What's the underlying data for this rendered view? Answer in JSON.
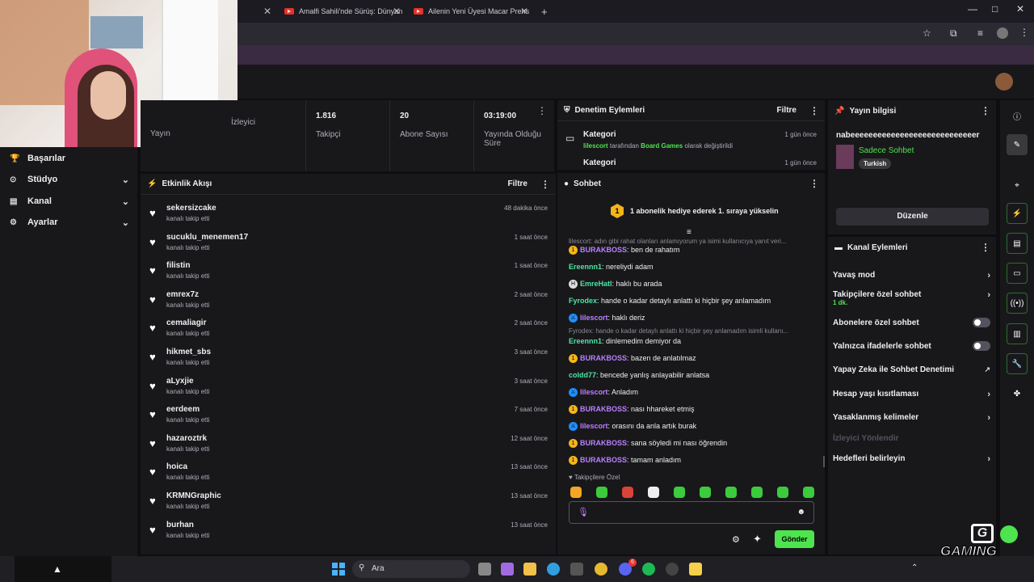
{
  "browser": {
    "tabs": [
      {
        "title": "Amalfi Sahili'nde Sürüş: Dünyan"
      },
      {
        "title": "Ailenin Yeni Üyesi Macar Prens"
      }
    ],
    "new_tab": "+"
  },
  "sidebar": {
    "items": [
      {
        "label": "Başarılar",
        "icon": "trophy-icon"
      },
      {
        "label": "Stüdyo",
        "icon": "studio-icon"
      },
      {
        "label": "Kanal",
        "icon": "channel-icon"
      },
      {
        "label": "Ayarlar",
        "icon": "gear-icon"
      }
    ]
  },
  "stats": {
    "items": [
      {
        "value": "",
        "label": "Yayın"
      },
      {
        "value": "",
        "label": "İzleyici"
      },
      {
        "value": "1.816",
        "label": "Takipçi"
      },
      {
        "value": "20",
        "label": "Abone Sayısı"
      },
      {
        "value": "03:19:00",
        "label": "Yayında Olduğu Süre"
      }
    ]
  },
  "activity": {
    "title": "Etkinlik Akışı",
    "filter": "Filtre",
    "events": [
      {
        "name": "sekersizcake",
        "sub": "kanalı takip etti",
        "time": "48 dakika önce"
      },
      {
        "name": "sucuklu_menemen17",
        "sub": "kanalı takip etti",
        "time": "1 saat önce"
      },
      {
        "name": "filistin",
        "sub": "kanalı takip etti",
        "time": "1 saat önce"
      },
      {
        "name": "emrex7z",
        "sub": "kanalı takip etti",
        "time": "2 saat önce"
      },
      {
        "name": "cemaliagir",
        "sub": "kanalı takip etti",
        "time": "2 saat önce"
      },
      {
        "name": "hikmet_sbs",
        "sub": "kanalı takip etti",
        "time": "3 saat önce"
      },
      {
        "name": "aLyxjie",
        "sub": "kanalı takip etti",
        "time": "3 saat önce"
      },
      {
        "name": "eerdeem",
        "sub": "kanalı takip etti",
        "time": "7 saat önce"
      },
      {
        "name": "hazaroztrk",
        "sub": "kanalı takip etti",
        "time": "12 saat önce"
      },
      {
        "name": "hoica",
        "sub": "kanalı takip etti",
        "time": "13 saat önce"
      },
      {
        "name": "KRMNGraphic",
        "sub": "kanalı takip etti",
        "time": "13 saat önce"
      },
      {
        "name": "burhan",
        "sub": "kanalı takip etti",
        "time": "13 saat önce"
      }
    ]
  },
  "moderation": {
    "title": "Denetim Eylemleri",
    "filter": "Filtre",
    "entries": [
      {
        "title": "Kategori",
        "user": "lilescort",
        "mid": " tarafından ",
        "game": "Board Games",
        "tail": " olarak değiştirildi",
        "time": "1 gün önce"
      },
      {
        "title": "Kategori",
        "time": "1 gün önce"
      }
    ]
  },
  "chat": {
    "title": "Sohbet",
    "banner": "1 abonelik hediye ederek 1. sıraya yükselin",
    "reply1": "lilescort: adın gibi rahat olanları anlamıyorum ya isimi kullanıcıya yanıt veri...",
    "reply2": "Fyrodex: hande o kadar detaylı anlattı ki hiçbir şey anlamadım isimli kullanı...",
    "messages": [
      {
        "user": "BURAKBOSS",
        "color": "#b980ff",
        "text": ": ben de rahatım"
      },
      {
        "user": "Ereennn1",
        "color": "#4ee6a3",
        "text": ": nereliydi adam"
      },
      {
        "user": "EmreHatl",
        "color": "#4ee6a3",
        "text": ": haklı bu arada"
      },
      {
        "user": "Fyrodex",
        "color": "#4ee6a3",
        "text": ": hande o kadar detaylı anlattı ki hiçbir şey anlamadım"
      },
      {
        "user": "lilescort",
        "color": "#b980ff",
        "text": ": haklı deriz"
      },
      {
        "user": "Ereennn1",
        "color": "#4ee6a3",
        "text": ": dinlemedim demiyor da"
      },
      {
        "user": "BURAKBOSS",
        "color": "#b980ff",
        "text": ": bazen de anlatılmaz"
      },
      {
        "user": "coldd77",
        "color": "#4ee6a3",
        "text": ": bencede yanlış anlayabilir anlatsa"
      },
      {
        "user": "lilescort",
        "color": "#b980ff",
        "text": ": Anladım"
      },
      {
        "user": "BURAKBOSS",
        "color": "#b980ff",
        "text": ": nası hhareket etmiş"
      },
      {
        "user": "lilescort",
        "color": "#b980ff",
        "text": ": orasını da anla artık burak"
      },
      {
        "user": "BURAKBOSS",
        "color": "#b980ff",
        "text": ": sana söyledi mi nası öğrendin"
      },
      {
        "user": "BURAKBOSS",
        "color": "#b980ff",
        "text": ": tamam anladım"
      }
    ],
    "followers_only": "Takipçilere Özel",
    "send": "Gönder"
  },
  "stream_info": {
    "title": "Yayın bilgisi",
    "stream_title": "nabeeeeeeeeeeeeeeeeeeeeeeeeeeeer",
    "category": "Sadece Sohbet",
    "tag": "Turkish",
    "edit": "Düzenle"
  },
  "channel_actions": {
    "title": "Kanal Eylemleri",
    "items": [
      {
        "label": "Yavaş mod",
        "control": "chevron"
      },
      {
        "label": "Takipçilere özel sohbet",
        "sub": "1 dk.",
        "control": "chevron"
      },
      {
        "label": "Abonelere özel sohbet",
        "control": "toggle",
        "value": "off"
      },
      {
        "label": "Yalnızca ifadelerle sohbet",
        "control": "toggle",
        "value": "off"
      },
      {
        "label": "Yapay Zeka ile Sohbet Denetimi",
        "control": "external"
      },
      {
        "label": "Hesap yaşı kısıtlaması",
        "control": "chevron"
      },
      {
        "label": "Yasaklanmış kelimeler",
        "control": "chevron"
      },
      {
        "label": "İzleyici Yönlendir",
        "control": "none"
      },
      {
        "label": "Hedefleri belirleyin",
        "control": "chevron"
      }
    ]
  },
  "taskbar": {
    "search": "Ara",
    "discord_badge": "6"
  },
  "watermark": {
    "text": "GAMING"
  },
  "colors": {
    "accent_green": "#4ee44e",
    "accent_purple": "#b980ff",
    "panel": "#18181b",
    "bg": "#0e0e10"
  }
}
